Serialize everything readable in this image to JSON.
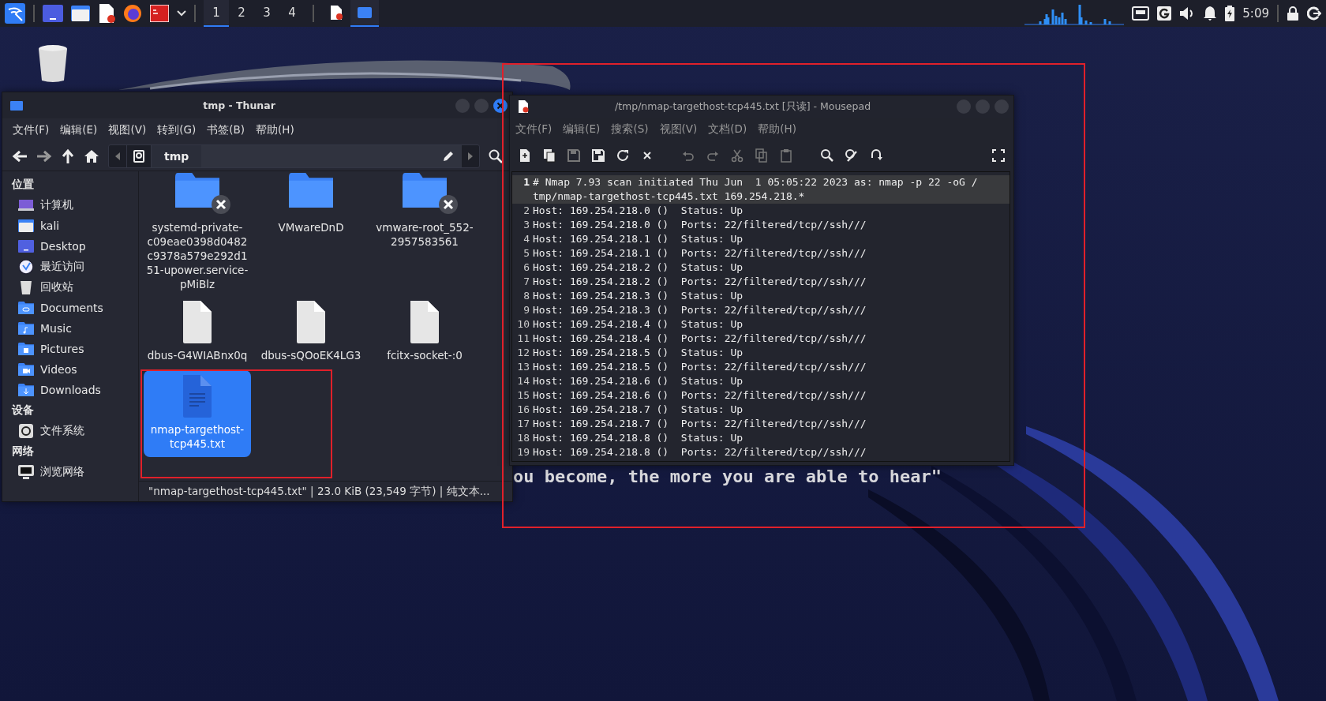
{
  "taskbar": {
    "workspaces": [
      {
        "label": "1",
        "selected": true
      },
      {
        "label": "2",
        "selected": false
      },
      {
        "label": "3",
        "selected": false
      },
      {
        "label": "4",
        "selected": false
      }
    ],
    "tasks": [
      {
        "kind": "editor",
        "selected": false
      },
      {
        "kind": "files",
        "selected": true
      }
    ],
    "clock": "5:09"
  },
  "desktop": {
    "quote": "ou become, the more you are able to hear\""
  },
  "thunar": {
    "title": "tmp - Thunar",
    "menu": [
      "文件(F)",
      "编辑(E)",
      "视图(V)",
      "转到(G)",
      "书签(B)",
      "帮助(H)"
    ],
    "path": "tmp",
    "sidebar": [
      {
        "heading": "位置",
        "items": [
          {
            "label": "计算机",
            "kind": "computer"
          },
          {
            "label": "kali",
            "kind": "home"
          },
          {
            "label": "Desktop",
            "kind": "desktop"
          },
          {
            "label": "最近访问",
            "kind": "recent"
          },
          {
            "label": "回收站",
            "kind": "trash"
          },
          {
            "label": "Documents",
            "kind": "documents"
          },
          {
            "label": "Music",
            "kind": "music"
          },
          {
            "label": "Pictures",
            "kind": "pictures"
          },
          {
            "label": "Videos",
            "kind": "videos"
          },
          {
            "label": "Downloads",
            "kind": "downloads"
          }
        ]
      },
      {
        "heading": "设备",
        "items": [
          {
            "label": "文件系统",
            "kind": "drive"
          }
        ]
      },
      {
        "heading": "网络",
        "items": [
          {
            "label": "浏览网络",
            "kind": "network"
          }
        ]
      }
    ],
    "files": [
      {
        "name": "systemd-private-c09eae0398d0482c9378a579e292d151-upower.service-pMiBlz",
        "kind": "folder",
        "locked": true,
        "selected": false
      },
      {
        "name": "VMwareDnD",
        "kind": "folder",
        "locked": false,
        "selected": false
      },
      {
        "name": "vmware-root_552-2957583561",
        "kind": "folder",
        "locked": true,
        "selected": false
      },
      {
        "name": "dbus-G4WIABnx0q",
        "kind": "file",
        "locked": false,
        "selected": false
      },
      {
        "name": "dbus-sQOoEK4LG3",
        "kind": "file",
        "locked": false,
        "selected": false
      },
      {
        "name": "fcitx-socket-:0",
        "kind": "file",
        "locked": false,
        "selected": false
      },
      {
        "name": "nmap-targethost-tcp445.txt",
        "kind": "text",
        "locked": false,
        "selected": true
      }
    ],
    "status": "\"nmap-targethost-tcp445.txt\" | 23.0 KiB (23,549 字节) | 纯文本..."
  },
  "mousepad": {
    "title": "/tmp/nmap-targethost-tcp445.txt [只读] - Mousepad",
    "menu": [
      "文件(F)",
      "编辑(E)",
      "搜索(S)",
      "视图(V)",
      "文档(D)",
      "帮助(H)"
    ],
    "toolbar": [
      {
        "kind": "new",
        "disabled": false
      },
      {
        "kind": "new-window",
        "disabled": false
      },
      {
        "kind": "save",
        "disabled": true
      },
      {
        "kind": "save-as",
        "disabled": false
      },
      {
        "kind": "reload",
        "disabled": false
      },
      {
        "kind": "close",
        "disabled": false
      },
      {
        "kind": "undo",
        "disabled": true
      },
      {
        "kind": "redo",
        "disabled": true
      },
      {
        "kind": "cut",
        "disabled": true
      },
      {
        "kind": "copy",
        "disabled": true
      },
      {
        "kind": "paste",
        "disabled": true
      },
      {
        "kind": "search",
        "disabled": false
      },
      {
        "kind": "replace",
        "disabled": false
      },
      {
        "kind": "goto",
        "disabled": false
      },
      {
        "kind": "fullscreen",
        "disabled": false
      }
    ],
    "lines": [
      {
        "number": "1",
        "text": "# Nmap 7.93 scan initiated Thu Jun  1 05:05:22 2023 as: nmap -p 22 -oG /tmp/nmap-targethost-tcp445.txt 169.254.218.*",
        "current": true
      },
      {
        "number": "2",
        "text": "Host: 169.254.218.0 ()  Status: Up",
        "current": false
      },
      {
        "number": "3",
        "text": "Host: 169.254.218.0 ()  Ports: 22/filtered/tcp//ssh///",
        "current": false
      },
      {
        "number": "4",
        "text": "Host: 169.254.218.1 ()  Status: Up",
        "current": false
      },
      {
        "number": "5",
        "text": "Host: 169.254.218.1 ()  Ports: 22/filtered/tcp//ssh///",
        "current": false
      },
      {
        "number": "6",
        "text": "Host: 169.254.218.2 ()  Status: Up",
        "current": false
      },
      {
        "number": "7",
        "text": "Host: 169.254.218.2 ()  Ports: 22/filtered/tcp//ssh///",
        "current": false
      },
      {
        "number": "8",
        "text": "Host: 169.254.218.3 ()  Status: Up",
        "current": false
      },
      {
        "number": "9",
        "text": "Host: 169.254.218.3 ()  Ports: 22/filtered/tcp//ssh///",
        "current": false
      },
      {
        "number": "10",
        "text": "Host: 169.254.218.4 ()  Status: Up",
        "current": false
      },
      {
        "number": "11",
        "text": "Host: 169.254.218.4 ()  Ports: 22/filtered/tcp//ssh///",
        "current": false
      },
      {
        "number": "12",
        "text": "Host: 169.254.218.5 ()  Status: Up",
        "current": false
      },
      {
        "number": "13",
        "text": "Host: 169.254.218.5 ()  Ports: 22/filtered/tcp//ssh///",
        "current": false
      },
      {
        "number": "14",
        "text": "Host: 169.254.218.6 ()  Status: Up",
        "current": false
      },
      {
        "number": "15",
        "text": "Host: 169.254.218.6 ()  Ports: 22/filtered/tcp//ssh///",
        "current": false
      },
      {
        "number": "16",
        "text": "Host: 169.254.218.7 ()  Status: Up",
        "current": false
      },
      {
        "number": "17",
        "text": "Host: 169.254.218.7 ()  Ports: 22/filtered/tcp//ssh///",
        "current": false
      },
      {
        "number": "18",
        "text": "Host: 169.254.218.8 ()  Status: Up",
        "current": false
      },
      {
        "number": "19",
        "text": "Host: 169.254.218.8 ()  Ports: 22/filtered/tcp//ssh///",
        "current": false
      }
    ]
  }
}
